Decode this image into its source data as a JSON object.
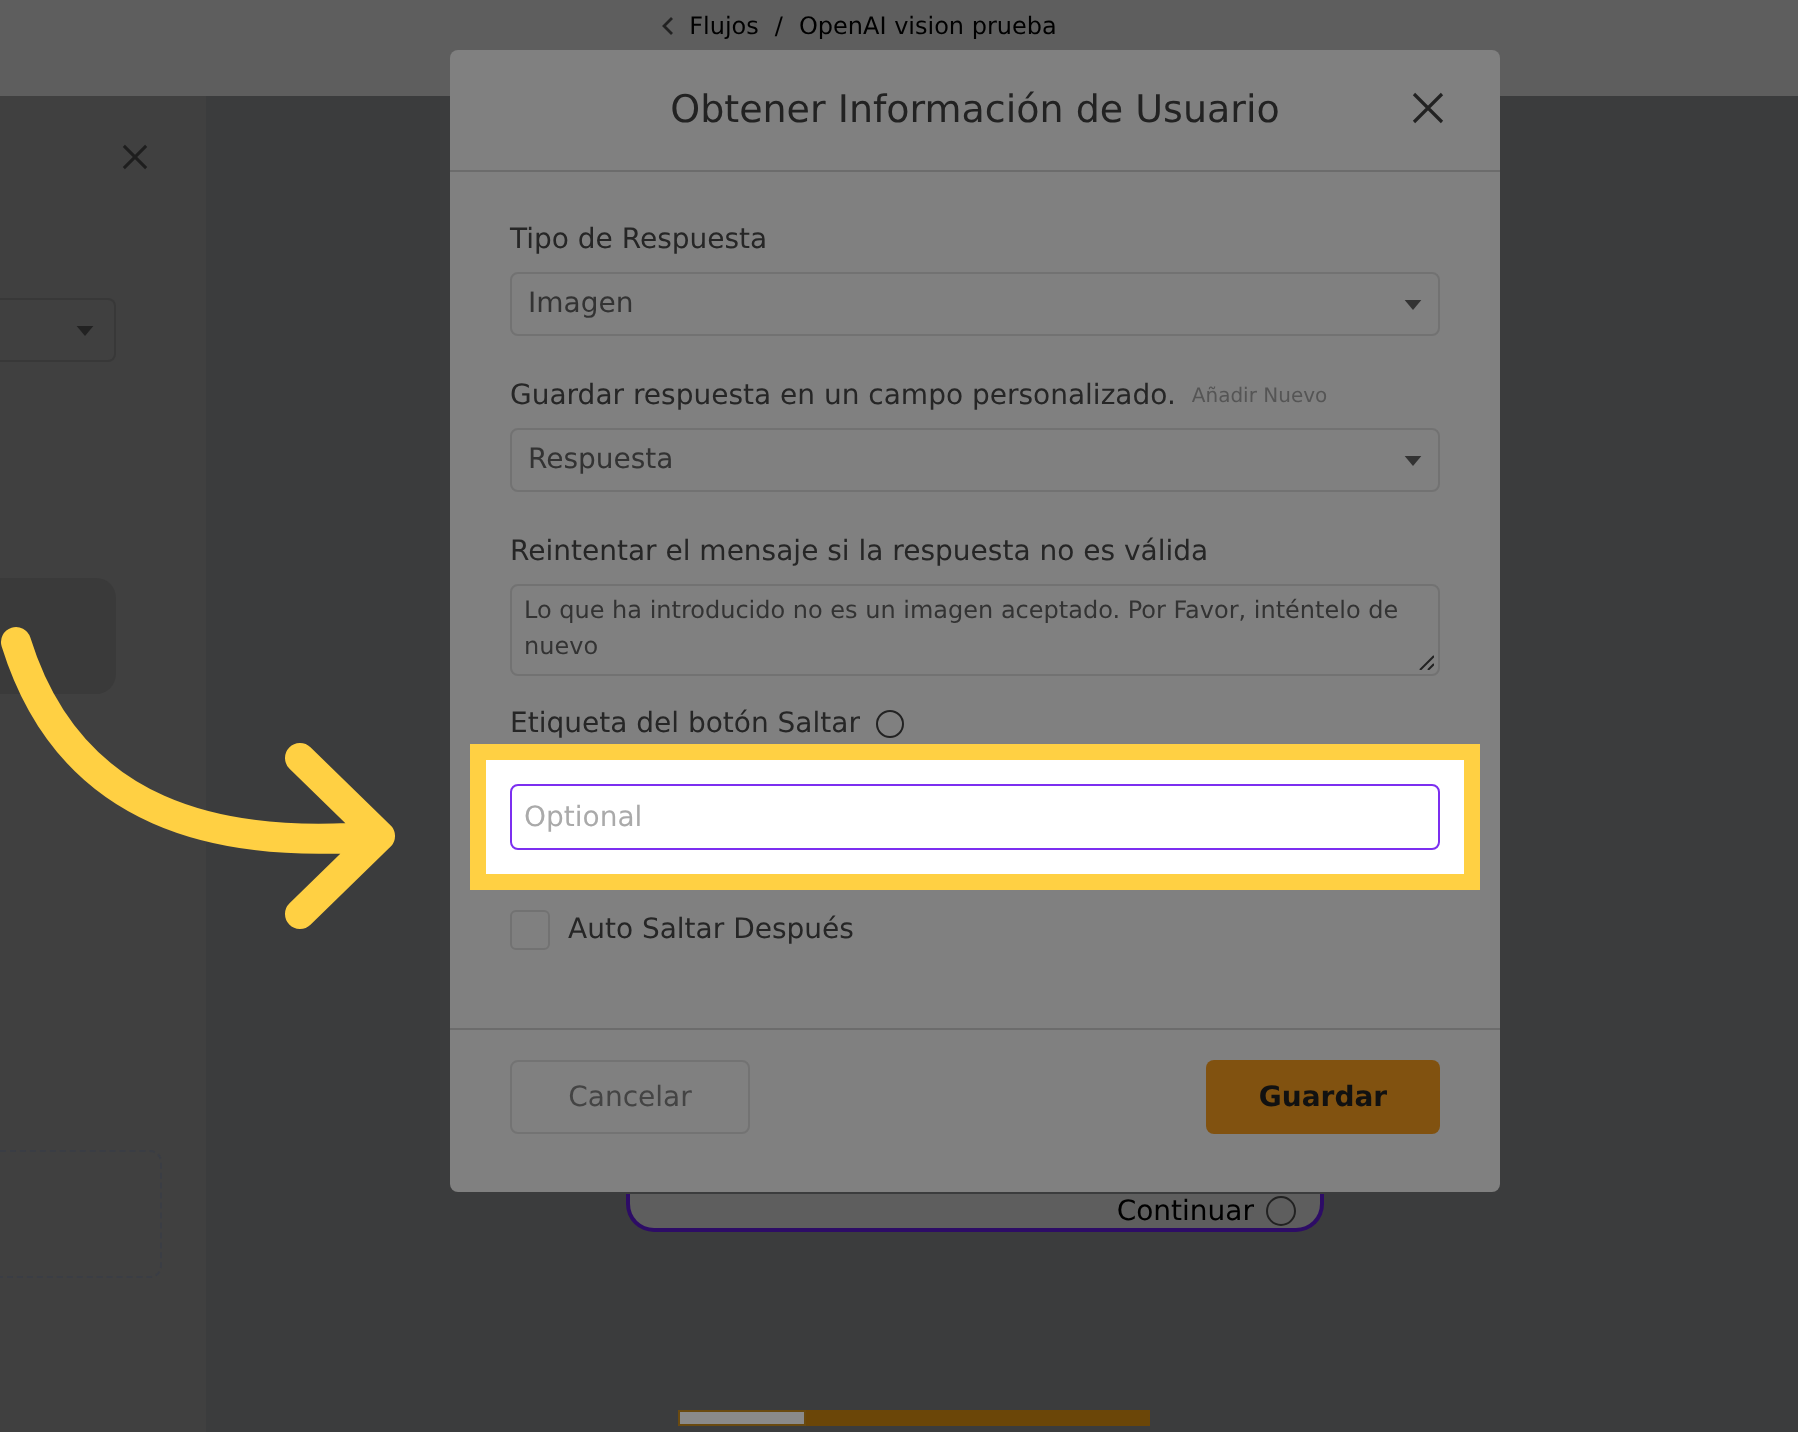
{
  "breadcrumb": {
    "back": "Flujos",
    "separator": "/",
    "current": "OpenAI vision prueba"
  },
  "canvas": {
    "node_button": "Continuar"
  },
  "modal": {
    "title": "Obtener Información de Usuario",
    "fields": [
      {
        "kind": "select",
        "label": "Tipo de Respuesta",
        "value": "Imagen"
      },
      {
        "kind": "select",
        "label": "Guardar respuesta en un campo personalizado.",
        "link": "Añadir Nuevo",
        "value": "Respuesta"
      },
      {
        "kind": "textarea",
        "label": "Reintentar el mensaje si la respuesta no es válida",
        "value": "Lo que ha introducido no es un imagen aceptado. Por Favor, inténtelo de nuevo"
      },
      {
        "kind": "text",
        "label": "Etiqueta del botón Saltar",
        "help": true,
        "placeholder": "Optional",
        "highlighted": true
      },
      {
        "kind": "checkbox",
        "label": "Auto Saltar Después",
        "checked": false
      }
    ],
    "buttons": [
      {
        "label": "Cancelar",
        "kind": "secondary"
      },
      {
        "label": "Guardar",
        "kind": "primary"
      }
    ]
  }
}
